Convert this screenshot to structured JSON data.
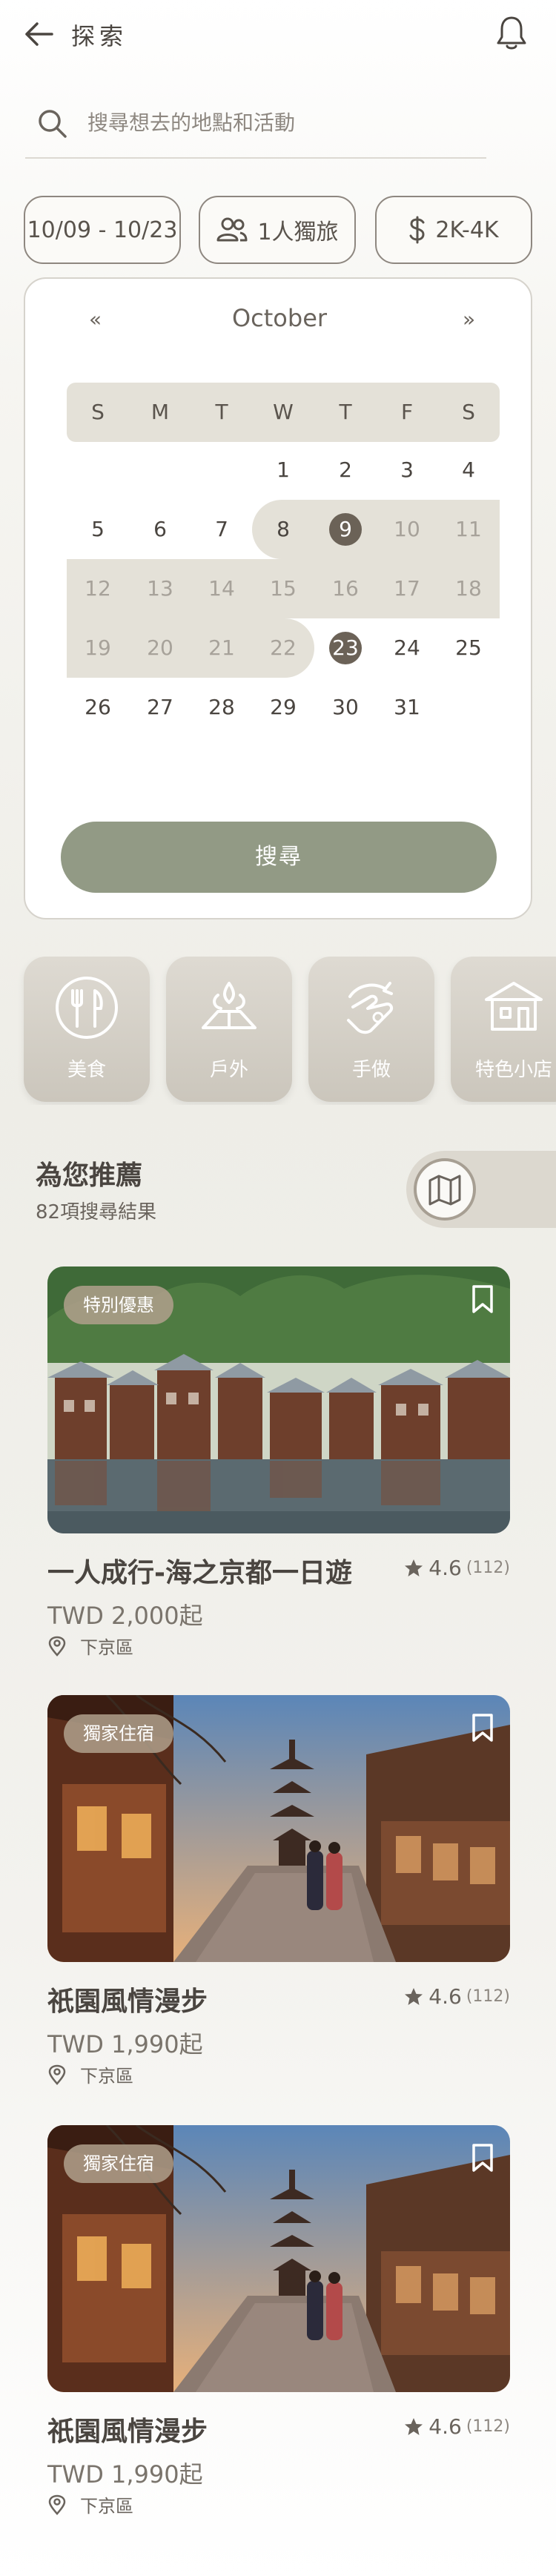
{
  "header": {
    "title": "探索"
  },
  "search": {
    "placeholder": "搜尋想去的地點和活動"
  },
  "filters": {
    "dates": "10/09 - 10/23",
    "people": "1人獨旅",
    "budget": "2K-4K"
  },
  "calendar": {
    "prev": "«",
    "next": "»",
    "month": "October",
    "weekdays": [
      "S",
      "M",
      "T",
      "W",
      "T",
      "F",
      "S"
    ],
    "days": [
      "1",
      "2",
      "3",
      "4",
      "5",
      "6",
      "7",
      "8",
      "9",
      "10",
      "11",
      "12",
      "13",
      "14",
      "15",
      "16",
      "17",
      "18",
      "19",
      "20",
      "21",
      "22",
      "23",
      "24",
      "25",
      "26",
      "27",
      "28",
      "29",
      "30",
      "31"
    ],
    "selected_start": 9,
    "selected_end": 23,
    "search_label": "搜尋"
  },
  "categories": [
    {
      "label": "美食",
      "icon": "fork-knife-icon"
    },
    {
      "label": "戶外",
      "icon": "tent-icon"
    },
    {
      "label": "手做",
      "icon": "handcraft-icon"
    },
    {
      "label": "特色小店",
      "icon": "shop-icon"
    }
  ],
  "recommend": {
    "title": "為您推薦",
    "count": "82項搜尋結果",
    "map_icon": "map-icon"
  },
  "cards": [
    {
      "badge": "特別優惠",
      "title": "一人成行-海之京都一日遊",
      "rating": "4.6",
      "reviews": "(112)",
      "price": "TWD 2,000起",
      "location": "下京區"
    },
    {
      "badge": "獨家住宿",
      "title": "祇園風情漫步",
      "rating": "4.6",
      "reviews": "(112)",
      "price": "TWD 1,990起",
      "location": "下京區"
    },
    {
      "badge": "獨家住宿",
      "title": "祇園風情漫步",
      "rating": "4.6",
      "reviews": "(112)",
      "price": "TWD 1,990起",
      "location": "下京區"
    }
  ],
  "colors": {
    "accent": "#929a85",
    "selected_day": "#6b6257",
    "range_band": "#e4e1d8"
  }
}
